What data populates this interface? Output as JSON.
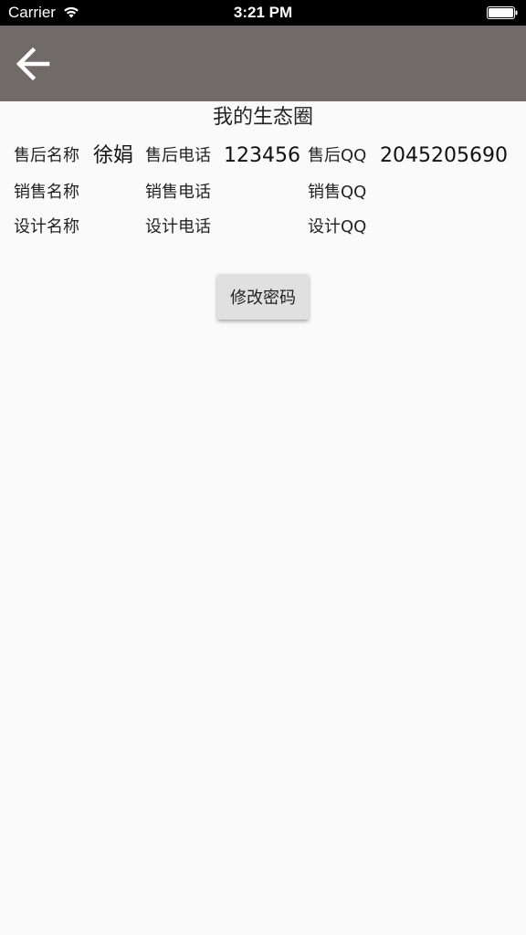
{
  "status_bar": {
    "carrier": "Carrier",
    "time": "3:21 PM"
  },
  "app_bar": {
    "background": "#706b69",
    "back_icon": "arrow-left-icon"
  },
  "page": {
    "title": "我的生态圈"
  },
  "info_rows": [
    {
      "name_label": "售后名称",
      "name_value": "徐娟",
      "phone_label": "售后电话",
      "phone_value": "123456",
      "qq_label": "售后QQ",
      "qq_value": "2045205690"
    },
    {
      "name_label": "销售名称",
      "name_value": "",
      "phone_label": "销售电话",
      "phone_value": "",
      "qq_label": "销售QQ",
      "qq_value": ""
    },
    {
      "name_label": "设计名称",
      "name_value": "",
      "phone_label": "设计电话",
      "phone_value": "",
      "qq_label": "设计QQ",
      "qq_value": ""
    }
  ],
  "actions": {
    "modify_password_label": "修改密码"
  }
}
